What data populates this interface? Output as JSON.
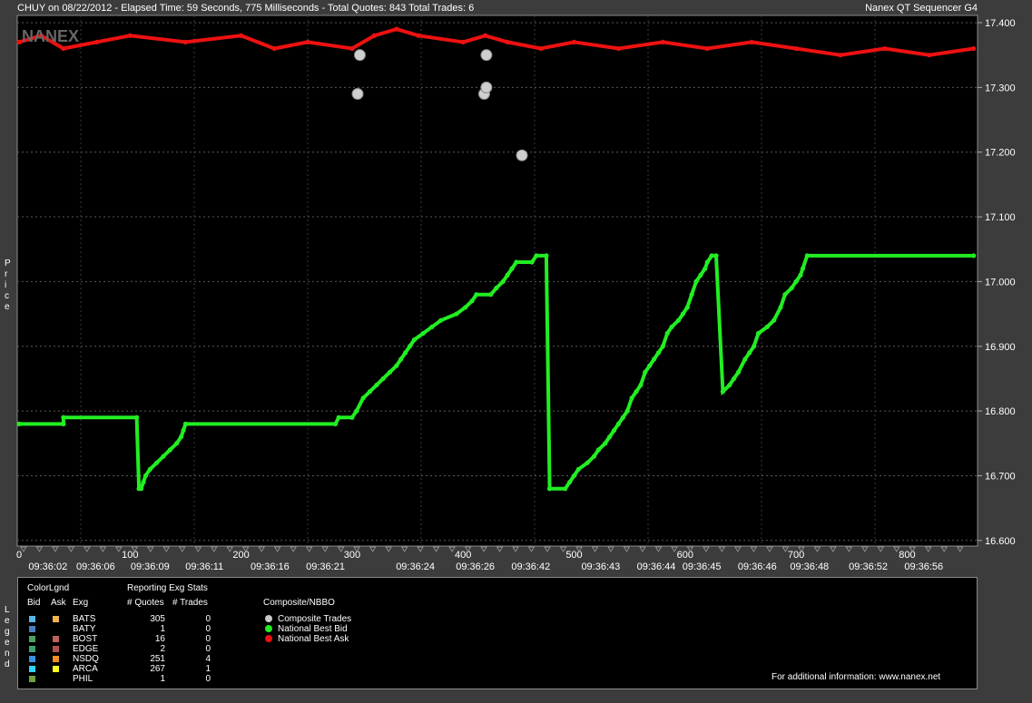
{
  "header": {
    "left": "CHUY on 08/22/2012  -  Elapsed Time: 59 Seconds, 775 Milliseconds  -  Total Quotes: 843  Total Trades: 6",
    "right": "Nanex QT Sequencer G4"
  },
  "watermark": "NANEX",
  "y_axis_label": "Price",
  "legend_side_label": "Legend",
  "chart_data": {
    "type": "line",
    "ylim": [
      16.59,
      17.405
    ],
    "xlim": [
      0,
      860
    ],
    "y_ticks": [
      "17.400",
      "17.300",
      "17.200",
      "17.100",
      "17.000",
      "16.900",
      "16.800",
      "16.700",
      "16.600"
    ],
    "x_ticks": [
      "0",
      "100",
      "200",
      "300",
      "400",
      "500",
      "600",
      "700",
      "800"
    ],
    "time_labels": [
      {
        "x": 26,
        "label": "09:36:02"
      },
      {
        "x": 69,
        "label": "09:36:06"
      },
      {
        "x": 118,
        "label": "09:36:09"
      },
      {
        "x": 167,
        "label": "09:36:11"
      },
      {
        "x": 226,
        "label": "09:36:16"
      },
      {
        "x": 276,
        "label": "09:36:21"
      },
      {
        "x": 357,
        "label": "09:36:24"
      },
      {
        "x": 411,
        "label": "09:36:26"
      },
      {
        "x": 461,
        "label": "09:36:42"
      },
      {
        "x": 524,
        "label": "09:36:43"
      },
      {
        "x": 574,
        "label": "09:36:44"
      },
      {
        "x": 615,
        "label": "09:36:45"
      },
      {
        "x": 665,
        "label": "09:36:46"
      },
      {
        "x": 712,
        "label": "09:36:48"
      },
      {
        "x": 765,
        "label": "09:36:52"
      },
      {
        "x": 815,
        "label": "09:36:56"
      }
    ],
    "composite_trades": [
      {
        "x": 307,
        "y": 17.35
      },
      {
        "x": 305,
        "y": 17.29
      },
      {
        "x": 419,
        "y": 17.29
      },
      {
        "x": 421,
        "y": 17.3
      },
      {
        "x": 421,
        "y": 17.35
      },
      {
        "x": 453,
        "y": 17.195
      }
    ],
    "best_bid": [
      [
        0,
        16.78
      ],
      [
        40,
        16.78
      ],
      [
        40,
        16.79
      ],
      [
        106,
        16.79
      ],
      [
        108,
        16.68
      ],
      [
        110,
        16.68
      ],
      [
        112,
        16.69
      ],
      [
        114,
        16.7
      ],
      [
        118,
        16.71
      ],
      [
        124,
        16.72
      ],
      [
        130,
        16.73
      ],
      [
        136,
        16.74
      ],
      [
        142,
        16.75
      ],
      [
        146,
        16.76
      ],
      [
        148,
        16.77
      ],
      [
        150,
        16.78
      ],
      [
        285,
        16.78
      ],
      [
        288,
        16.79
      ],
      [
        300,
        16.79
      ],
      [
        304,
        16.8
      ],
      [
        310,
        16.82
      ],
      [
        316,
        16.83
      ],
      [
        322,
        16.84
      ],
      [
        328,
        16.85
      ],
      [
        334,
        16.86
      ],
      [
        340,
        16.87
      ],
      [
        344,
        16.88
      ],
      [
        348,
        16.89
      ],
      [
        352,
        16.9
      ],
      [
        356,
        16.91
      ],
      [
        364,
        16.92
      ],
      [
        372,
        16.93
      ],
      [
        380,
        16.94
      ],
      [
        394,
        16.95
      ],
      [
        402,
        16.96
      ],
      [
        408,
        16.97
      ],
      [
        412,
        16.98
      ],
      [
        425,
        16.98
      ],
      [
        430,
        16.99
      ],
      [
        436,
        17.0
      ],
      [
        440,
        17.01
      ],
      [
        444,
        17.02
      ],
      [
        448,
        17.03
      ],
      [
        462,
        17.03
      ],
      [
        466,
        17.04
      ],
      [
        475,
        17.04
      ],
      [
        478,
        16.68
      ],
      [
        478,
        16.68
      ],
      [
        492,
        16.68
      ],
      [
        496,
        16.69
      ],
      [
        500,
        16.7
      ],
      [
        504,
        16.71
      ],
      [
        512,
        16.72
      ],
      [
        518,
        16.73
      ],
      [
        522,
        16.74
      ],
      [
        528,
        16.75
      ],
      [
        532,
        16.76
      ],
      [
        536,
        16.77
      ],
      [
        540,
        16.78
      ],
      [
        544,
        16.79
      ],
      [
        548,
        16.8
      ],
      [
        552,
        16.82
      ],
      [
        556,
        16.83
      ],
      [
        560,
        16.84
      ],
      [
        564,
        16.86
      ],
      [
        568,
        16.87
      ],
      [
        572,
        16.88
      ],
      [
        576,
        16.89
      ],
      [
        580,
        16.9
      ],
      [
        584,
        16.92
      ],
      [
        588,
        16.93
      ],
      [
        594,
        16.94
      ],
      [
        598,
        16.95
      ],
      [
        602,
        16.96
      ],
      [
        606,
        16.98
      ],
      [
        610,
        17.0
      ],
      [
        614,
        17.01
      ],
      [
        618,
        17.02
      ],
      [
        620,
        17.03
      ],
      [
        624,
        17.04
      ],
      [
        628,
        17.04
      ],
      [
        634,
        16.83
      ],
      [
        640,
        16.84
      ],
      [
        644,
        16.85
      ],
      [
        648,
        16.86
      ],
      [
        654,
        16.88
      ],
      [
        658,
        16.89
      ],
      [
        662,
        16.9
      ],
      [
        666,
        16.92
      ],
      [
        674,
        16.93
      ],
      [
        680,
        16.94
      ],
      [
        686,
        16.96
      ],
      [
        690,
        16.98
      ],
      [
        696,
        16.99
      ],
      [
        700,
        17.0
      ],
      [
        704,
        17.01
      ],
      [
        706,
        17.02
      ],
      [
        710,
        17.04
      ],
      [
        860,
        17.04
      ]
    ],
    "best_ask": [
      [
        0,
        17.37
      ],
      [
        20,
        17.38
      ],
      [
        40,
        17.36
      ],
      [
        70,
        17.37
      ],
      [
        100,
        17.38
      ],
      [
        150,
        17.37
      ],
      [
        200,
        17.38
      ],
      [
        230,
        17.36
      ],
      [
        260,
        17.37
      ],
      [
        300,
        17.36
      ],
      [
        320,
        17.38
      ],
      [
        340,
        17.39
      ],
      [
        360,
        17.38
      ],
      [
        400,
        17.37
      ],
      [
        420,
        17.38
      ],
      [
        440,
        17.37
      ],
      [
        470,
        17.36
      ],
      [
        500,
        17.37
      ],
      [
        540,
        17.36
      ],
      [
        580,
        17.37
      ],
      [
        620,
        17.36
      ],
      [
        660,
        17.37
      ],
      [
        700,
        17.36
      ],
      [
        740,
        17.35
      ],
      [
        780,
        17.36
      ],
      [
        820,
        17.35
      ],
      [
        860,
        17.36
      ]
    ],
    "x_extra_labels_note": ""
  },
  "legend": {
    "title": "ColorLgnd",
    "col_bid": "Bid",
    "col_ask": "Ask",
    "col_exg": "Exg",
    "stats_title": "Reporting Exg Stats",
    "col_quotes": "# Quotes",
    "col_trades": "# Trades",
    "composite_title": "Composite/NBBO",
    "rows": [
      {
        "exg": "BATS",
        "quotes": "305",
        "trades": "0",
        "bid_color": "#5ab4e6",
        "ask_color": "#f0b450"
      },
      {
        "exg": "BATY",
        "quotes": "1",
        "trades": "0",
        "bid_color": "#4a7ec0",
        "ask_color": ""
      },
      {
        "exg": "BOST",
        "quotes": "16",
        "trades": "0",
        "bid_color": "#50a060",
        "ask_color": "#c06060"
      },
      {
        "exg": "EDGE",
        "quotes": "2",
        "trades": "0",
        "bid_color": "#40a070",
        "ask_color": "#b05050"
      },
      {
        "exg": "NSDQ",
        "quotes": "251",
        "trades": "4",
        "bid_color": "#3a90e0",
        "ask_color": "#f09020"
      },
      {
        "exg": "ARCA",
        "quotes": "267",
        "trades": "1",
        "bid_color": "#30d0ff",
        "ask_color": "#ffff20"
      },
      {
        "exg": "PHIL",
        "quotes": "1",
        "trades": "0",
        "bid_color": "#70a040",
        "ask_color": ""
      }
    ],
    "composite_items": [
      {
        "label": "Composite Trades",
        "color": "#c8c8c8"
      },
      {
        "label": "National Best Bid",
        "color": "#22ee22"
      },
      {
        "label": "National Best Ask",
        "color": "#ee1111"
      }
    ],
    "footer": "For additional information: www.nanex.net"
  }
}
